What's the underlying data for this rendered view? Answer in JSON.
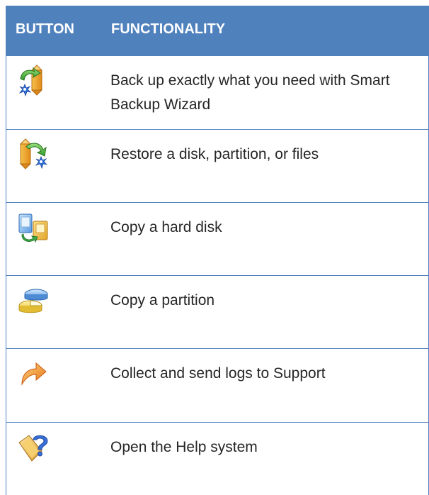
{
  "header": {
    "col_button": "BUTTON",
    "col_functionality": "FUNCTIONALITY"
  },
  "rows": [
    {
      "icon": "backup-wizard-icon",
      "text": "Back up exactly what you need with Smart Backup Wizard"
    },
    {
      "icon": "restore-icon",
      "text": "Restore a disk, partition, or files"
    },
    {
      "icon": "copy-disk-icon",
      "text": "Copy a hard disk"
    },
    {
      "icon": "copy-partition-icon",
      "text": "Copy a partition"
    },
    {
      "icon": "send-logs-icon",
      "text": "Collect and send logs to Support"
    },
    {
      "icon": "help-icon",
      "text": "Open the Help system"
    }
  ],
  "colors": {
    "header_bg": "#4f81bd",
    "header_text": "#ffffff",
    "body_text": "#262626"
  }
}
